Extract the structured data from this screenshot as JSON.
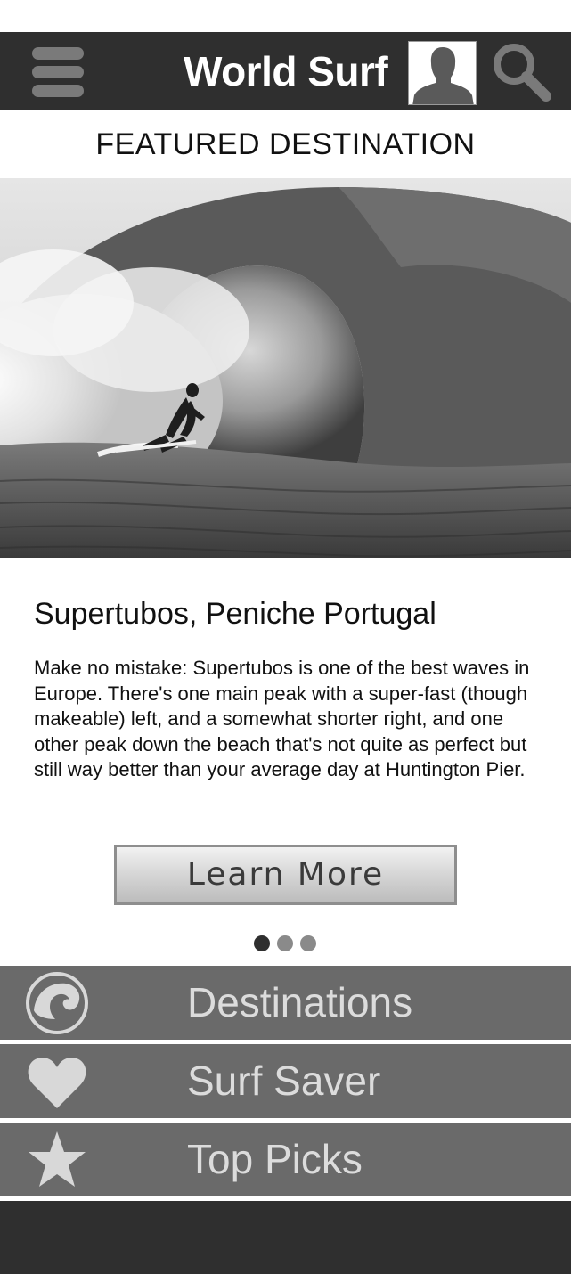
{
  "header": {
    "title": "World Surf",
    "menu_icon": "hamburger-menu-icon",
    "avatar_icon": "user-avatar-icon",
    "search_icon": "search-icon"
  },
  "featured": {
    "heading": "FEATURED DESTINATION",
    "image_subject": "surfer riding inside a barrel wave",
    "title": "Supertubos, Peniche Portugal",
    "description": "Make no mistake: Supertubos is one of the best waves in Europe. There's one main peak with a super-fast (though makeable) left, and a somewhat shorter right, and one other peak down the beach that's not quite as perfect but still way better than your average day at Huntington Pier.",
    "button_label": "Learn More",
    "carousel": {
      "total": 3,
      "active_index": 0
    }
  },
  "nav": {
    "items": [
      {
        "label": "Destinations",
        "icon": "wave-icon"
      },
      {
        "label": "Surf Saver",
        "icon": "heart-icon"
      },
      {
        "label": "Top Picks",
        "icon": "star-icon"
      }
    ]
  },
  "colors": {
    "header_bg": "#2f2f2f",
    "nav_bg": "#6a6a6a",
    "nav_text": "#dcdcdc",
    "dot_active": "#2f2f2f",
    "dot_inactive": "#8a8a8a"
  }
}
